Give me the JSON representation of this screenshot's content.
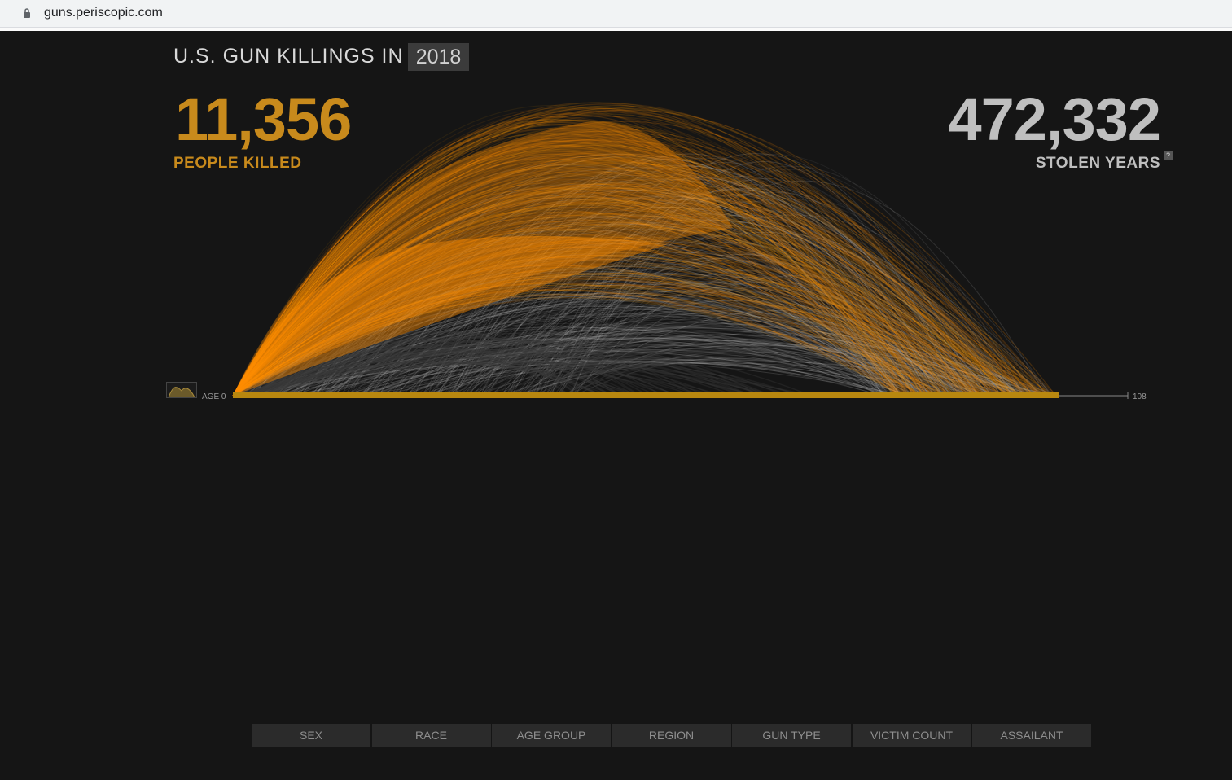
{
  "browser": {
    "url": "guns.periscopic.com"
  },
  "header": {
    "title": "U.S. GUN KILLINGS IN",
    "year": "2018"
  },
  "stats": {
    "people_killed": "11,356",
    "people_killed_label": "PEOPLE KILLED",
    "stolen_years": "472,332",
    "stolen_years_label": "STOLEN YEARS",
    "help": "?"
  },
  "axis": {
    "start_label": "AGE 0",
    "end_label": "108"
  },
  "filters": [
    "SEX",
    "RACE",
    "AGE GROUP",
    "REGION",
    "GUN TYPE",
    "VICTIM COUNT",
    "ASSAILANT"
  ],
  "colors": {
    "background": "#151515",
    "killed_orange": "#c88a1c",
    "arc_orange": "#ff8c00",
    "arc_gray": "#c8c8c8",
    "filter_bg": "#2b2b2b"
  }
}
